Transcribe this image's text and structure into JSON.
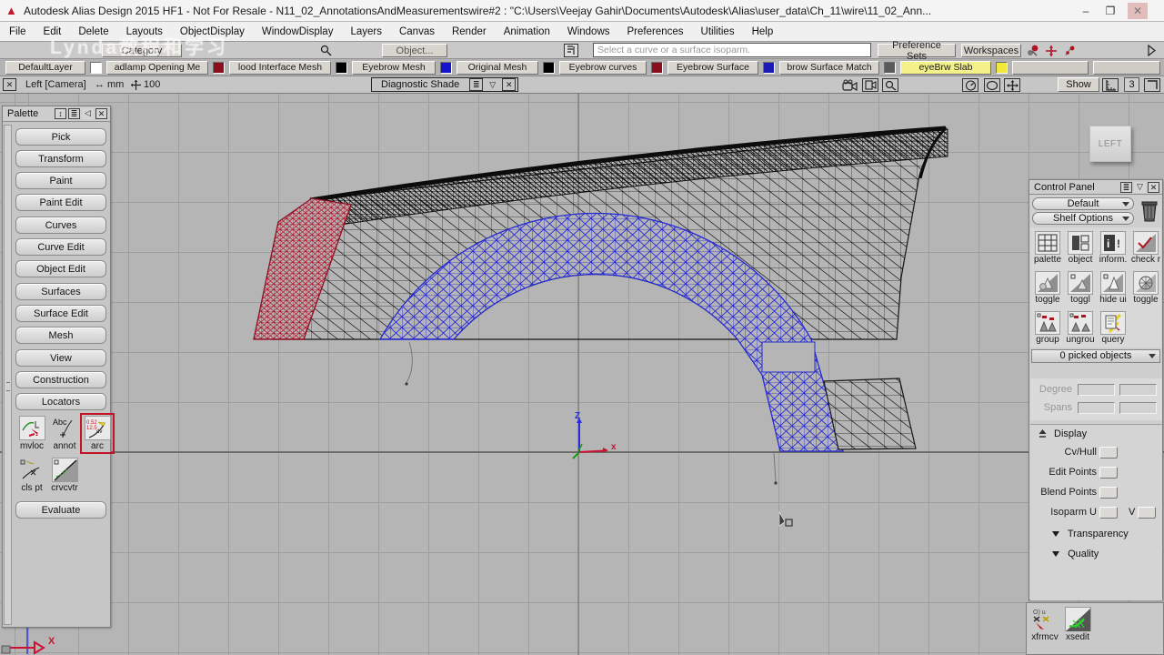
{
  "window": {
    "title": "Autodesk Alias Design 2015 HF1 - Not For Resale  - N11_02_AnnotationsAndMeasurementswire#2 : \"C:\\Users\\Veejay Gahir\\Documents\\Autodesk\\Alias\\user_data\\Ch_11\\wire\\11_02_Ann...",
    "min": "–",
    "max": "❐",
    "close": "✕",
    "logo": "▲"
  },
  "watermark": {
    "text": "Lynda教程和学习"
  },
  "menu": {
    "items": [
      "File",
      "Edit",
      "Delete",
      "Layouts",
      "ObjectDisplay",
      "WindowDisplay",
      "Layers",
      "Canvas",
      "Render",
      "Animation",
      "Windows",
      "Preferences",
      "Utilities",
      "Help"
    ]
  },
  "prompt": {
    "category": "Category",
    "object_btn": "Object...",
    "text": "Select a curve or a surface isoparm.",
    "pref_sets": "Preference Sets",
    "workspaces": "Workspaces"
  },
  "layers": {
    "items": [
      {
        "label": "DefaultLayer",
        "swatch": "#ffffff"
      },
      {
        "label": "adlamp Opening Me",
        "swatch": "#8b0e1e"
      },
      {
        "label": "lood Interface Mesh",
        "swatch": "#000000"
      },
      {
        "label": "Eyebrow Mesh",
        "swatch": "#1414cc"
      },
      {
        "label": "Original Mesh",
        "swatch": "#000000"
      },
      {
        "label": "Eyebrow curves",
        "swatch": "#8b0e1e"
      },
      {
        "label": "Eyebrow Surface",
        "swatch": "#1a1ab4"
      },
      {
        "label": "brow Surface Match",
        "swatch": "#5a5a5a"
      },
      {
        "label": "eyeBrw Slab",
        "swatch": "#f0e83a",
        "highlight": "#f4f08a"
      }
    ]
  },
  "vbar": {
    "view": "Left [Camera]",
    "units": "mm",
    "grid": "100",
    "shade": "Diagnostic Shade",
    "show": "Show",
    "three": "3"
  },
  "palette": {
    "title": "Palette",
    "tabs": [
      "Pick",
      "Transform",
      "Paint",
      "Paint Edit",
      "Curves",
      "Curve Edit",
      "Object Edit",
      "Surfaces",
      "Surface Edit",
      "Mesh",
      "View",
      "Construction",
      "Locators"
    ],
    "tools": [
      {
        "label": "mvloc"
      },
      {
        "label": "annot"
      },
      {
        "label": "arc"
      },
      {
        "label": "cls pt"
      },
      {
        "label": "crvcvtr"
      }
    ],
    "evaluate": "Evaluate"
  },
  "viewport": {
    "left_label": "LEFT",
    "z_label": "Z",
    "x_label": "x",
    "axis_x_label": "X"
  },
  "cp": {
    "title": "Control Panel",
    "preset": "Default",
    "shelf_options": "Shelf Options",
    "tools1": [
      "palette",
      "object",
      "inform.",
      "check r"
    ],
    "tools2": [
      "toggle",
      "toggl",
      "hide ui",
      "toggle"
    ],
    "tools3": [
      "group",
      "ungrou",
      "query"
    ],
    "picked": "0 picked objects",
    "degree": "Degree",
    "spans": "Spans",
    "display": "Display",
    "cv_hull": "Cv/Hull",
    "edit_points": "Edit Points",
    "blend_points": "Blend Points",
    "isoparm_u": "Isoparm U",
    "v_label": "V",
    "transparency": "Transparency",
    "quality": "Quality"
  },
  "shelf2": {
    "tools": [
      "xfrmcv",
      "xsedit"
    ]
  },
  "colors": {
    "viewport_bg": "#b5b5b5",
    "grid_line": "#9e9e9e",
    "mesh_black": "#1c1c1c",
    "mesh_red": "#b3122a",
    "mesh_blue": "#2629d6",
    "accent_red": "#c41325",
    "layer_highlight": "#f4f08a"
  }
}
